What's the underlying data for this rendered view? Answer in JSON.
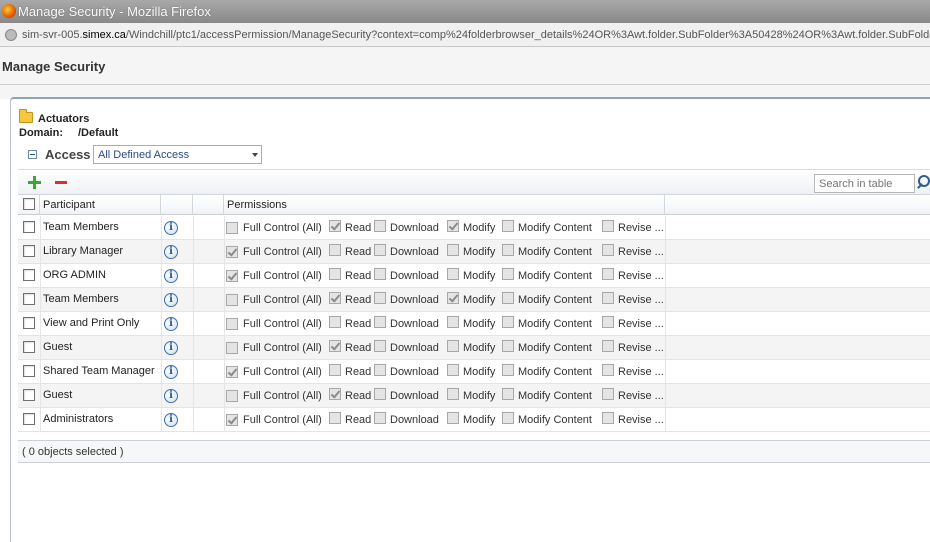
{
  "window": {
    "title": "Manage Security - Mozilla Firefox",
    "url_prefix": "sim-svr-005.",
    "url_host": "simex.ca",
    "url_rest": "/Windchill/ptc1/accessPermission/ManageSecurity?context=comp%24folderbrowser_details%24OR%3Awt.folder.SubFolder%3A50428%24OR%3Awt.folder.SubFolde"
  },
  "page": {
    "title": "Manage Security"
  },
  "folder": {
    "name": "Actuators",
    "domain_label": "Domain:",
    "domain_value": "/Default"
  },
  "access": {
    "label": "Access",
    "selected": "All Defined Access"
  },
  "search": {
    "placeholder": "Search in table"
  },
  "table": {
    "headers": {
      "participant": "Participant",
      "permissions": "Permissions"
    },
    "permission_names": [
      "Full Control (All)",
      "Read",
      "Download",
      "Modify",
      "Modify Content",
      "Revise ..."
    ],
    "rows": [
      {
        "participant": "Team Members",
        "perms": [
          false,
          true,
          false,
          true,
          false,
          false
        ]
      },
      {
        "participant": "Library Manager",
        "perms": [
          true,
          false,
          false,
          false,
          false,
          false
        ]
      },
      {
        "participant": "ORG ADMIN",
        "perms": [
          true,
          false,
          false,
          false,
          false,
          false
        ]
      },
      {
        "participant": "Team Members",
        "perms": [
          false,
          true,
          false,
          true,
          false,
          false
        ]
      },
      {
        "participant": "View and Print Only",
        "perms": [
          false,
          false,
          false,
          false,
          false,
          false
        ]
      },
      {
        "participant": "Guest",
        "perms": [
          false,
          true,
          false,
          false,
          false,
          false
        ]
      },
      {
        "participant": "Shared Team Manager",
        "perms": [
          true,
          false,
          false,
          false,
          false,
          false
        ]
      },
      {
        "participant": "Guest",
        "perms": [
          false,
          true,
          false,
          false,
          false,
          false
        ]
      },
      {
        "participant": "Administrators",
        "perms": [
          true,
          false,
          false,
          false,
          false,
          false
        ]
      }
    ]
  },
  "footer": {
    "selection_status": "( 0 objects selected )"
  },
  "colors": {
    "add": "#3aa833",
    "remove": "#d9302c",
    "info": "#1f58a8"
  }
}
